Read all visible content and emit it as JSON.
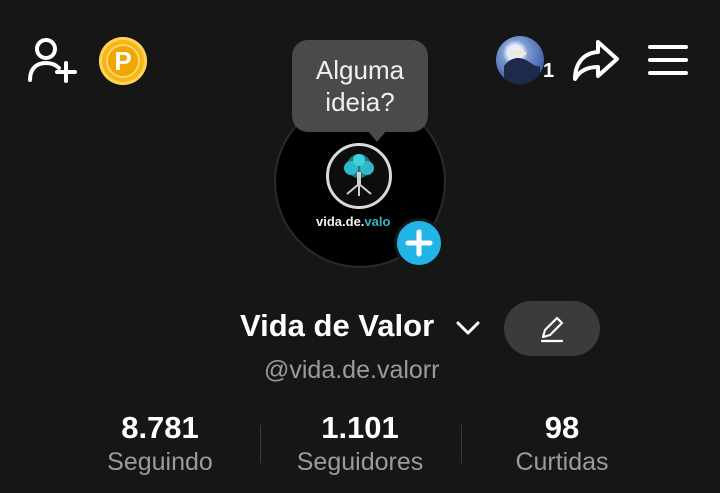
{
  "header": {
    "icons": [
      "add-friend-icon",
      "coin-icon",
      "story-avatar",
      "share-icon",
      "menu-icon"
    ],
    "coin_letter": "P",
    "story_count": "1"
  },
  "profile": {
    "tooltip_line1": "Alguma",
    "tooltip_line2": "ideia?",
    "logo_text_main": "vida.de.",
    "logo_text_accent": "valo",
    "display_name": "Vida de Valor",
    "username": "@vida.de.valorr"
  },
  "stats": [
    {
      "value": "8.781",
      "label": "Seguindo"
    },
    {
      "value": "1.101",
      "label": "Seguidores"
    },
    {
      "value": "98",
      "label": "Curtidas"
    }
  ],
  "colors": {
    "background": "#161616",
    "coin": "#f7b518",
    "plus_button": "#20b5e6",
    "accent_teal": "#2fb8c8",
    "muted_text": "#9b9b9b"
  }
}
